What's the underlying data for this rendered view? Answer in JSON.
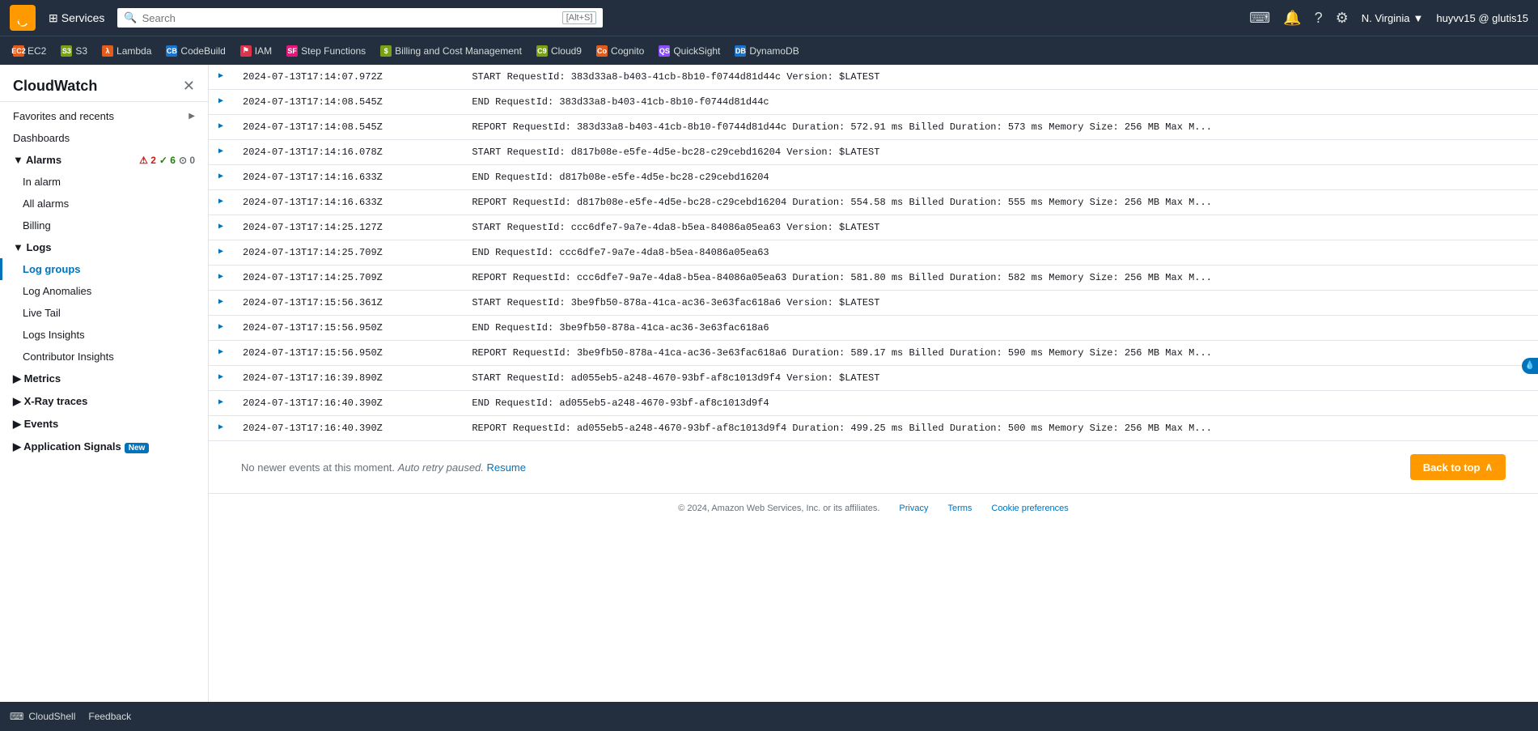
{
  "topnav": {
    "logo": "aws",
    "services_label": "Services",
    "search_placeholder": "Search",
    "search_shortcut": "[Alt+S]",
    "region": "N. Virginia",
    "user": "huyvv15 @ glutis15",
    "shell_icon": "⌨",
    "bell_icon": "🔔",
    "help_icon": "?",
    "settings_icon": "⚙"
  },
  "service_tabs": [
    {
      "id": "ec2",
      "label": "EC2",
      "icon_class": "tab-ec2",
      "icon_text": "EC2"
    },
    {
      "id": "s3",
      "label": "S3",
      "icon_class": "tab-s3",
      "icon_text": "S3"
    },
    {
      "id": "lambda",
      "label": "Lambda",
      "icon_class": "tab-lambda",
      "icon_text": "λ"
    },
    {
      "id": "codebuild",
      "label": "CodeBuild",
      "icon_class": "tab-codebuild",
      "icon_text": "CB"
    },
    {
      "id": "iam",
      "label": "IAM",
      "icon_class": "tab-iam",
      "icon_text": "IAM"
    },
    {
      "id": "stepfunctions",
      "label": "Step Functions",
      "icon_class": "tab-stepfunctions",
      "icon_text": "SF"
    },
    {
      "id": "billing",
      "label": "Billing and Cost Management",
      "icon_class": "tab-billing",
      "icon_text": "$"
    },
    {
      "id": "cloud9",
      "label": "Cloud9",
      "icon_class": "tab-cloud9",
      "icon_text": "C9"
    },
    {
      "id": "cognito",
      "label": "Cognito",
      "icon_class": "tab-cognito",
      "icon_text": "Co"
    },
    {
      "id": "quicksight",
      "label": "QuickSight",
      "icon_class": "tab-quicksight",
      "icon_text": "QS"
    },
    {
      "id": "dynamodb",
      "label": "DynamoDB",
      "icon_class": "tab-dynamodb",
      "icon_text": "DB"
    }
  ],
  "sidebar": {
    "title": "CloudWatch",
    "close_icon": "✕",
    "items": [
      {
        "id": "favorites",
        "label": "Favorites and recents",
        "indent": 0,
        "has_chevron": true,
        "active": false
      },
      {
        "id": "dashboards",
        "label": "Dashboards",
        "indent": 0,
        "active": false
      },
      {
        "id": "alarms-header",
        "label": "Alarms",
        "indent": 0,
        "active": false,
        "is_section": true,
        "badge": {
          "alarm_count": 2,
          "ok_count": 6,
          "insuf_count": 0
        }
      },
      {
        "id": "in-alarm",
        "label": "In alarm",
        "indent": 1,
        "active": false
      },
      {
        "id": "all-alarms",
        "label": "All alarms",
        "indent": 1,
        "active": false
      },
      {
        "id": "billing",
        "label": "Billing",
        "indent": 1,
        "active": false
      },
      {
        "id": "logs-header",
        "label": "Logs",
        "indent": 0,
        "active": false,
        "is_section": true
      },
      {
        "id": "log-groups",
        "label": "Log groups",
        "indent": 1,
        "active": true
      },
      {
        "id": "log-anomalies",
        "label": "Log Anomalies",
        "indent": 1,
        "active": false
      },
      {
        "id": "live-tail",
        "label": "Live Tail",
        "indent": 1,
        "active": false
      },
      {
        "id": "logs-insights",
        "label": "Logs Insights",
        "indent": 1,
        "active": false
      },
      {
        "id": "contributor-insights",
        "label": "Contributor Insights",
        "indent": 1,
        "active": false
      },
      {
        "id": "metrics",
        "label": "Metrics",
        "indent": 0,
        "active": false,
        "has_chevron": true
      },
      {
        "id": "xray",
        "label": "X-Ray traces",
        "indent": 0,
        "active": false,
        "has_chevron": true
      },
      {
        "id": "events",
        "label": "Events",
        "indent": 0,
        "active": false,
        "has_chevron": true
      },
      {
        "id": "application-signals",
        "label": "Application Signals",
        "indent": 0,
        "active": false,
        "has_chevron": true,
        "badge_new": "New"
      }
    ]
  },
  "log_entries": [
    {
      "id": 1,
      "timestamp": "2024-07-13T17:14:07.972Z",
      "message": "START RequestId: 383d33a8-b403-41cb-8b10-f0744d81d44c Version: $LATEST"
    },
    {
      "id": 2,
      "timestamp": "2024-07-13T17:14:08.545Z",
      "message": "END RequestId: 383d33a8-b403-41cb-8b10-f0744d81d44c"
    },
    {
      "id": 3,
      "timestamp": "2024-07-13T17:14:08.545Z",
      "message": "REPORT RequestId: 383d33a8-b403-41cb-8b10-f0744d81d44c Duration: 572.91 ms Billed Duration: 573 ms Memory Size: 256 MB Max M..."
    },
    {
      "id": 4,
      "timestamp": "2024-07-13T17:14:16.078Z",
      "message": "START RequestId: d817b08e-e5fe-4d5e-bc28-c29cebd16204 Version: $LATEST"
    },
    {
      "id": 5,
      "timestamp": "2024-07-13T17:14:16.633Z",
      "message": "END RequestId: d817b08e-e5fe-4d5e-bc28-c29cebd16204"
    },
    {
      "id": 6,
      "timestamp": "2024-07-13T17:14:16.633Z",
      "message": "REPORT RequestId: d817b08e-e5fe-4d5e-bc28-c29cebd16204 Duration: 554.58 ms Billed Duration: 555 ms Memory Size: 256 MB Max M..."
    },
    {
      "id": 7,
      "timestamp": "2024-07-13T17:14:25.127Z",
      "message": "START RequestId: ccc6dfe7-9a7e-4da8-b5ea-84086a05ea63 Version: $LATEST"
    },
    {
      "id": 8,
      "timestamp": "2024-07-13T17:14:25.709Z",
      "message": "END RequestId: ccc6dfe7-9a7e-4da8-b5ea-84086a05ea63"
    },
    {
      "id": 9,
      "timestamp": "2024-07-13T17:14:25.709Z",
      "message": "REPORT RequestId: ccc6dfe7-9a7e-4da8-b5ea-84086a05ea63 Duration: 581.80 ms Billed Duration: 582 ms Memory Size: 256 MB Max M..."
    },
    {
      "id": 10,
      "timestamp": "2024-07-13T17:15:56.361Z",
      "message": "START RequestId: 3be9fb50-878a-41ca-ac36-3e63fac618a6 Version: $LATEST"
    },
    {
      "id": 11,
      "timestamp": "2024-07-13T17:15:56.950Z",
      "message": "END RequestId: 3be9fb50-878a-41ca-ac36-3e63fac618a6"
    },
    {
      "id": 12,
      "timestamp": "2024-07-13T17:15:56.950Z",
      "message": "REPORT RequestId: 3be9fb50-878a-41ca-ac36-3e63fac618a6 Duration: 589.17 ms Billed Duration: 590 ms Memory Size: 256 MB Max M..."
    },
    {
      "id": 13,
      "timestamp": "2024-07-13T17:16:39.890Z",
      "message": "START RequestId: ad055eb5-a248-4670-93bf-af8c1013d9f4 Version: $LATEST"
    },
    {
      "id": 14,
      "timestamp": "2024-07-13T17:16:40.390Z",
      "message": "END RequestId: ad055eb5-a248-4670-93bf-af8c1013d9f4"
    },
    {
      "id": 15,
      "timestamp": "2024-07-13T17:16:40.390Z",
      "message": "REPORT RequestId: ad055eb5-a248-4670-93bf-af8c1013d9f4 Duration: 499.25 ms Billed Duration: 500 ms Memory Size: 256 MB Max M..."
    }
  ],
  "no_newer_events": "No newer events at this moment.",
  "auto_retry_paused": "Auto retry paused.",
  "resume_label": "Resume",
  "back_to_top_label": "Back to top",
  "footer": {
    "copyright": "© 2024, Amazon Web Services, Inc. or its affiliates.",
    "privacy": "Privacy",
    "terms": "Terms",
    "cookie": "Cookie preferences"
  },
  "bottom_bar": {
    "cloudshell_icon": "⌨",
    "cloudshell_label": "CloudShell",
    "feedback_label": "Feedback"
  }
}
